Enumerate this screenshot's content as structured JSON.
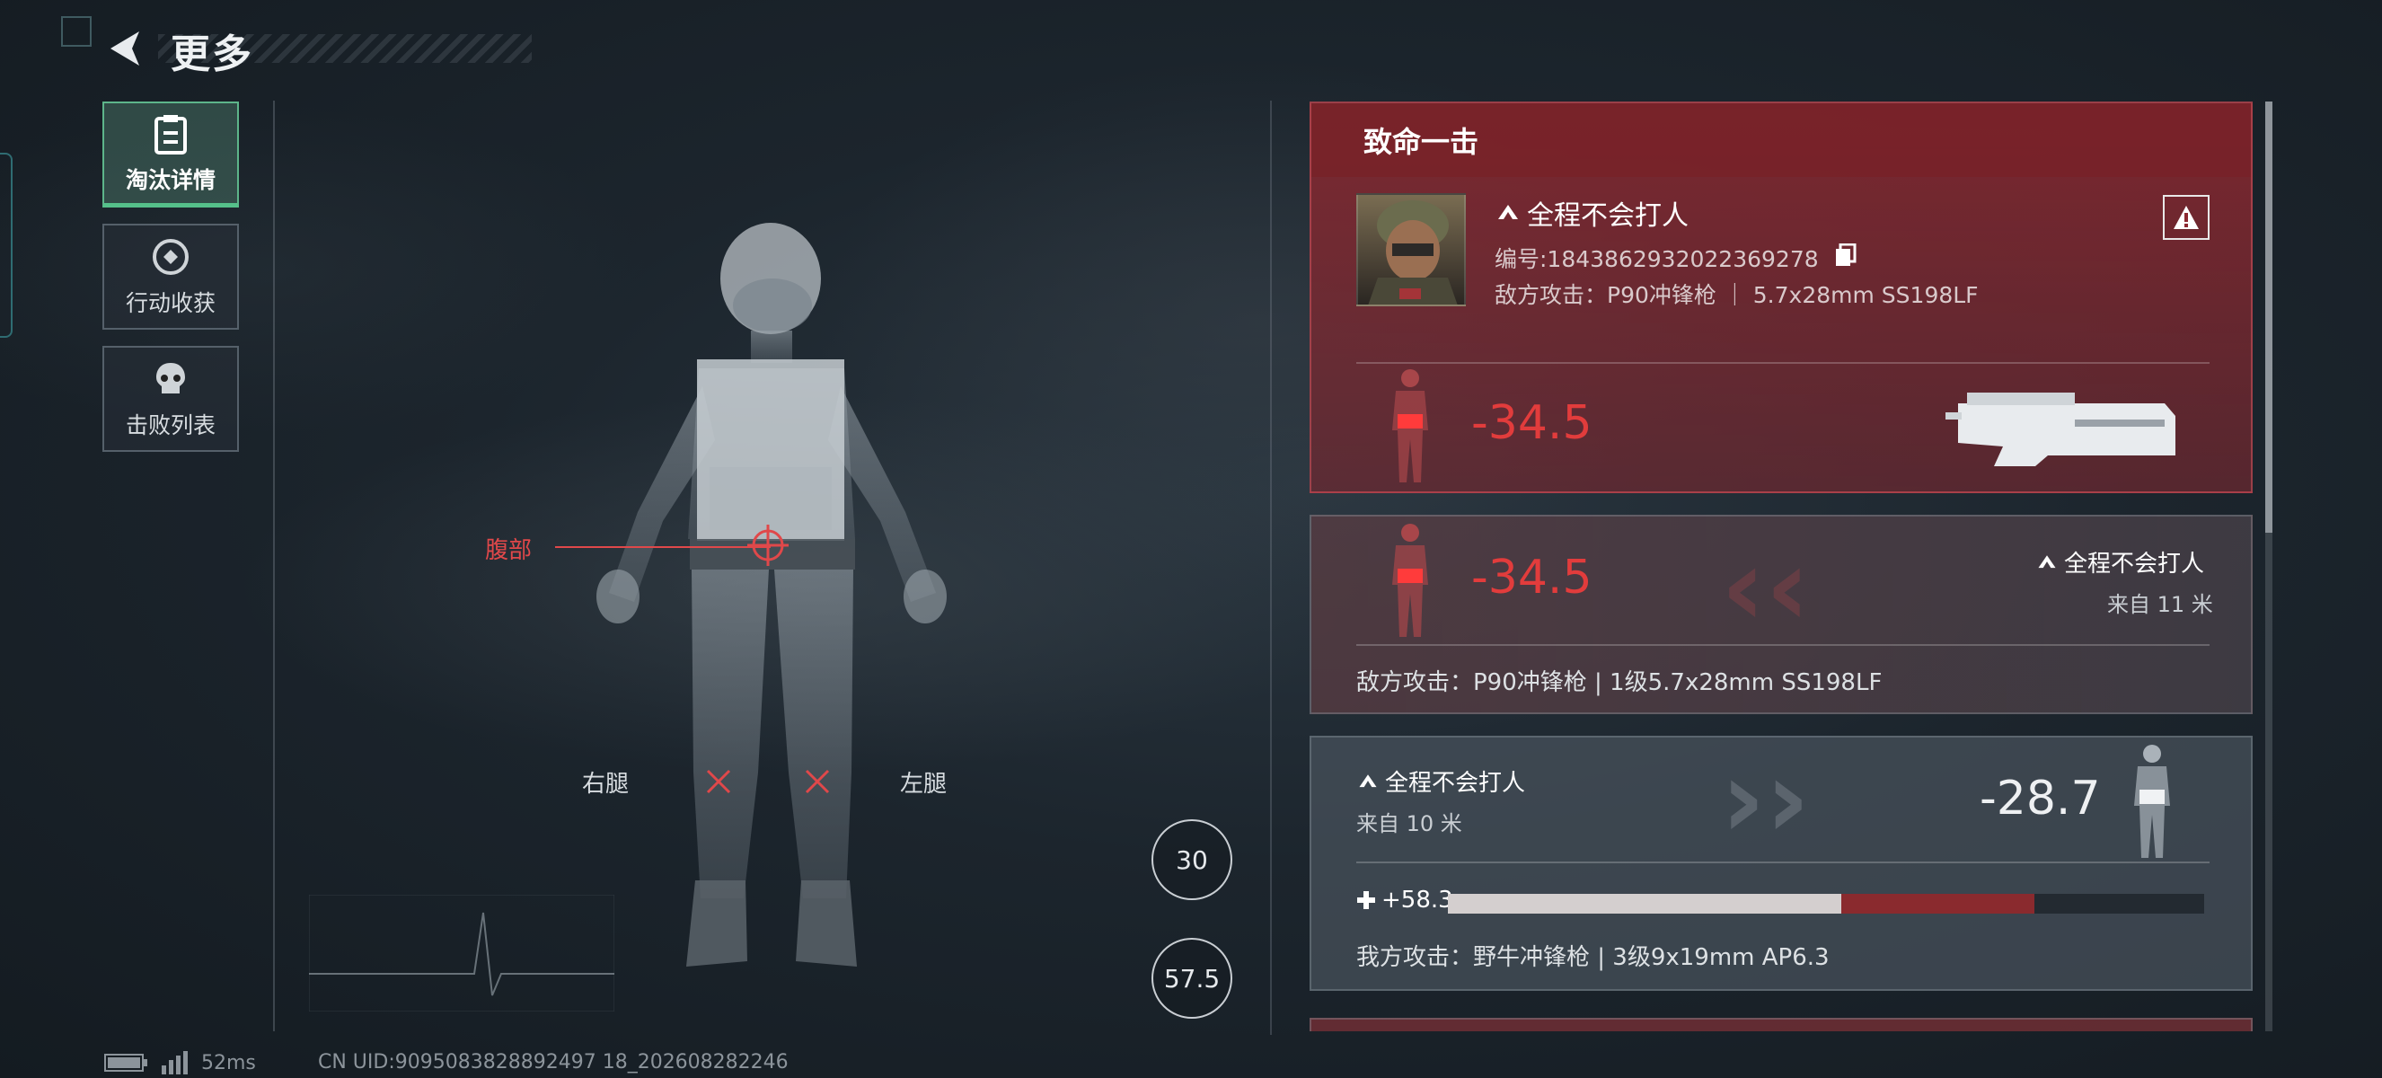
{
  "header": {
    "title": "更多"
  },
  "menu": {
    "items": [
      {
        "label": "淘汰详情",
        "icon": "clipboard-icon",
        "active": true
      },
      {
        "label": "行动收获",
        "icon": "coin-icon",
        "active": false
      },
      {
        "label": "击败列表",
        "icon": "skull-icon",
        "active": false
      }
    ]
  },
  "body_view": {
    "hit_labels": {
      "abdomen": "腹部",
      "right_leg": "右腿",
      "left_leg": "左腿"
    },
    "armor_helmet": "30",
    "armor_vest": "57.5"
  },
  "fatal_card": {
    "title": "致命一击",
    "player_name": "全程不会打人",
    "id_text": "编号:1843862932022369278",
    "attack_text": "敌方攻击：P90冲锋枪 ｜ 5.7x28mm SS198LF",
    "damage": "-34.5",
    "weapon_icon": "p90-smg-icon"
  },
  "hit_card_2": {
    "damage": "-34.5",
    "player_name": "全程不会打人",
    "distance": "来自 11 米",
    "attack_text": "敌方攻击：P90冲锋枪 | 1级5.7x28mm SS198LF"
  },
  "hit_card_3": {
    "player_name": "全程不会打人",
    "distance": "来自 10 米",
    "damage": "-28.7",
    "heal": "+58.3",
    "health_white_pct": 0.52,
    "health_red_pct": 0.255,
    "attack_text": "我方攻击：野牛冲锋枪 | 3级9x19mm AP6.3"
  },
  "footer": {
    "ping": "52ms",
    "uid": "CN UID:9095083828892497 18_202608282246"
  },
  "colors": {
    "accent_green": "#55c08a",
    "damage_red": "#e23c3c",
    "fatal_bg": "#8c2830"
  }
}
